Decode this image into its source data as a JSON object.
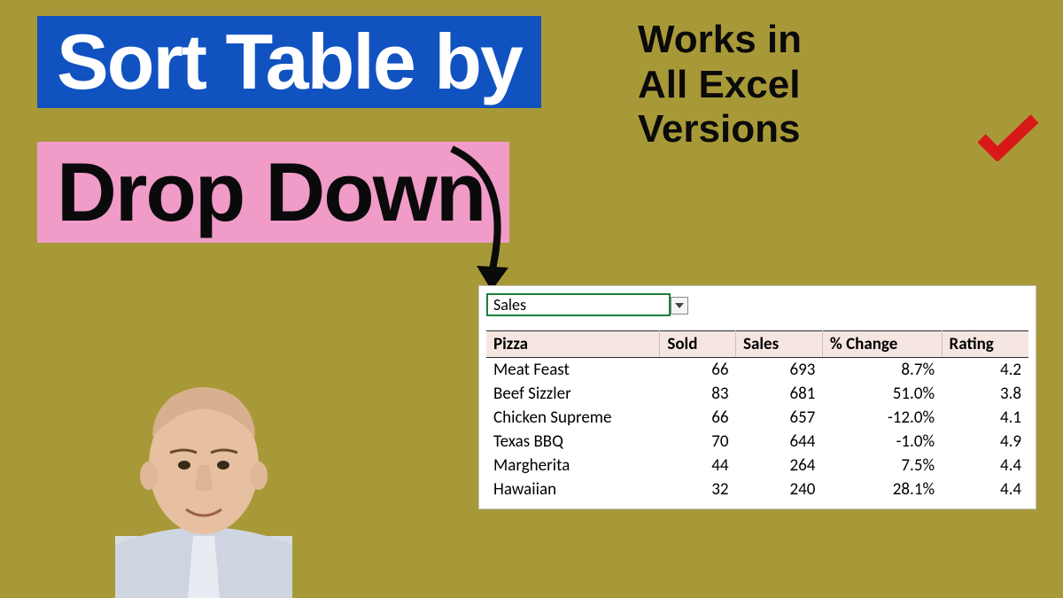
{
  "title": {
    "line1": "Sort Table by",
    "line2": "Drop Down"
  },
  "tagline": {
    "line1": "Works in",
    "line2": "All Excel",
    "line3": "Versions"
  },
  "dropdown": {
    "selected": "Sales"
  },
  "table": {
    "headers": [
      "Pizza",
      "Sold",
      "Sales",
      "% Change",
      "Rating"
    ],
    "rows": [
      {
        "pizza": "Meat Feast",
        "sold": "66",
        "sales": "693",
        "change": "8.7%",
        "rating": "4.2"
      },
      {
        "pizza": "Beef Sizzler",
        "sold": "83",
        "sales": "681",
        "change": "51.0%",
        "rating": "3.8"
      },
      {
        "pizza": "Chicken Supreme",
        "sold": "66",
        "sales": "657",
        "change": "-12.0%",
        "rating": "4.1"
      },
      {
        "pizza": "Texas BBQ",
        "sold": "70",
        "sales": "644",
        "change": "-1.0%",
        "rating": "4.9"
      },
      {
        "pizza": "Margherita",
        "sold": "44",
        "sales": "264",
        "change": "7.5%",
        "rating": "4.4"
      },
      {
        "pizza": "Hawaiian",
        "sold": "32",
        "sales": "240",
        "change": "28.1%",
        "rating": "4.4"
      }
    ]
  },
  "colors": {
    "background": "#a89938",
    "blue": "#1152c1",
    "pink": "#f09bc8",
    "check": "#d91818",
    "excel_green": "#1a7f3a",
    "header_bg": "#f5e6e1"
  }
}
